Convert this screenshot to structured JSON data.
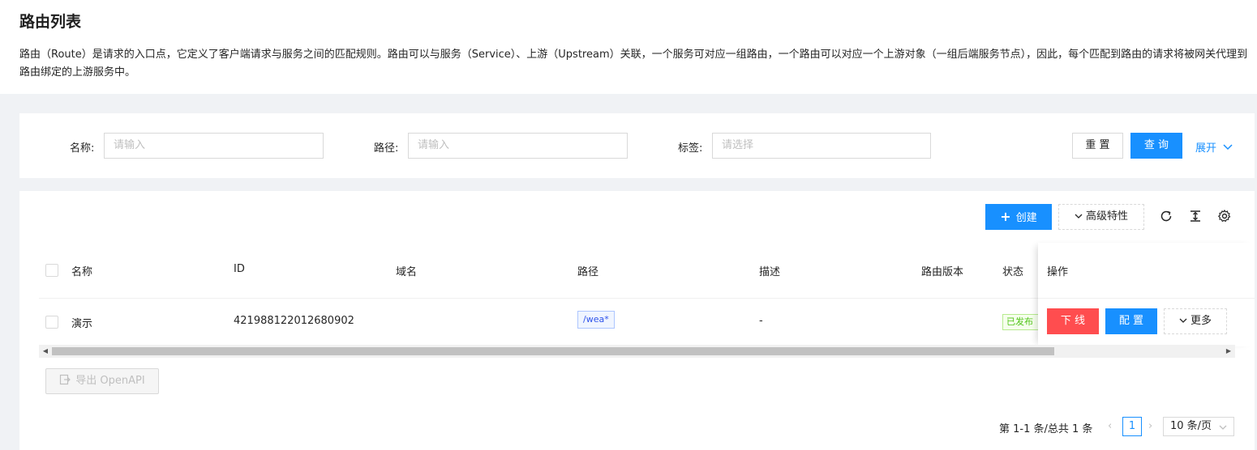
{
  "header": {
    "title": "路由列表",
    "description": "路由（Route）是请求的入口点，它定义了客户端请求与服务之间的匹配规则。路由可以与服务（Service）、上游（Upstream）关联，一个服务可对应一组路由，一个路由可以对应一个上游对象（一组后端服务节点），因此，每个匹配到路由的请求将被网关代理到路由绑定的上游服务中。"
  },
  "filter": {
    "name_label": "名称:",
    "name_placeholder": "请输入",
    "path_label": "路径:",
    "path_placeholder": "请输入",
    "tag_label": "标签:",
    "tag_placeholder": "请选择",
    "reset_label": "重 置",
    "query_label": "查 询",
    "expand_label": "展开"
  },
  "toolbar": {
    "create_label": "创建",
    "advanced_label": "高级特性"
  },
  "table": {
    "columns": [
      "名称",
      "ID",
      "域名",
      "路径",
      "描述",
      "路由版本",
      "状态",
      "操作"
    ],
    "rows": [
      {
        "name": "演示",
        "id": "421988122012680902",
        "domain": "",
        "path": "/wea*",
        "description": "-",
        "version": "",
        "status": "已发布",
        "action_offline": "下 线",
        "action_config": "配 置",
        "action_more": "更多"
      }
    ]
  },
  "export_label": "导出 OpenAPI",
  "pagination": {
    "summary": "第 1-1 条/总共 1 条",
    "current_page": "1",
    "page_size": "10 条/页"
  },
  "colors": {
    "primary": "#1890ff",
    "danger": "#ff4d4f",
    "success": "#52c41a"
  }
}
